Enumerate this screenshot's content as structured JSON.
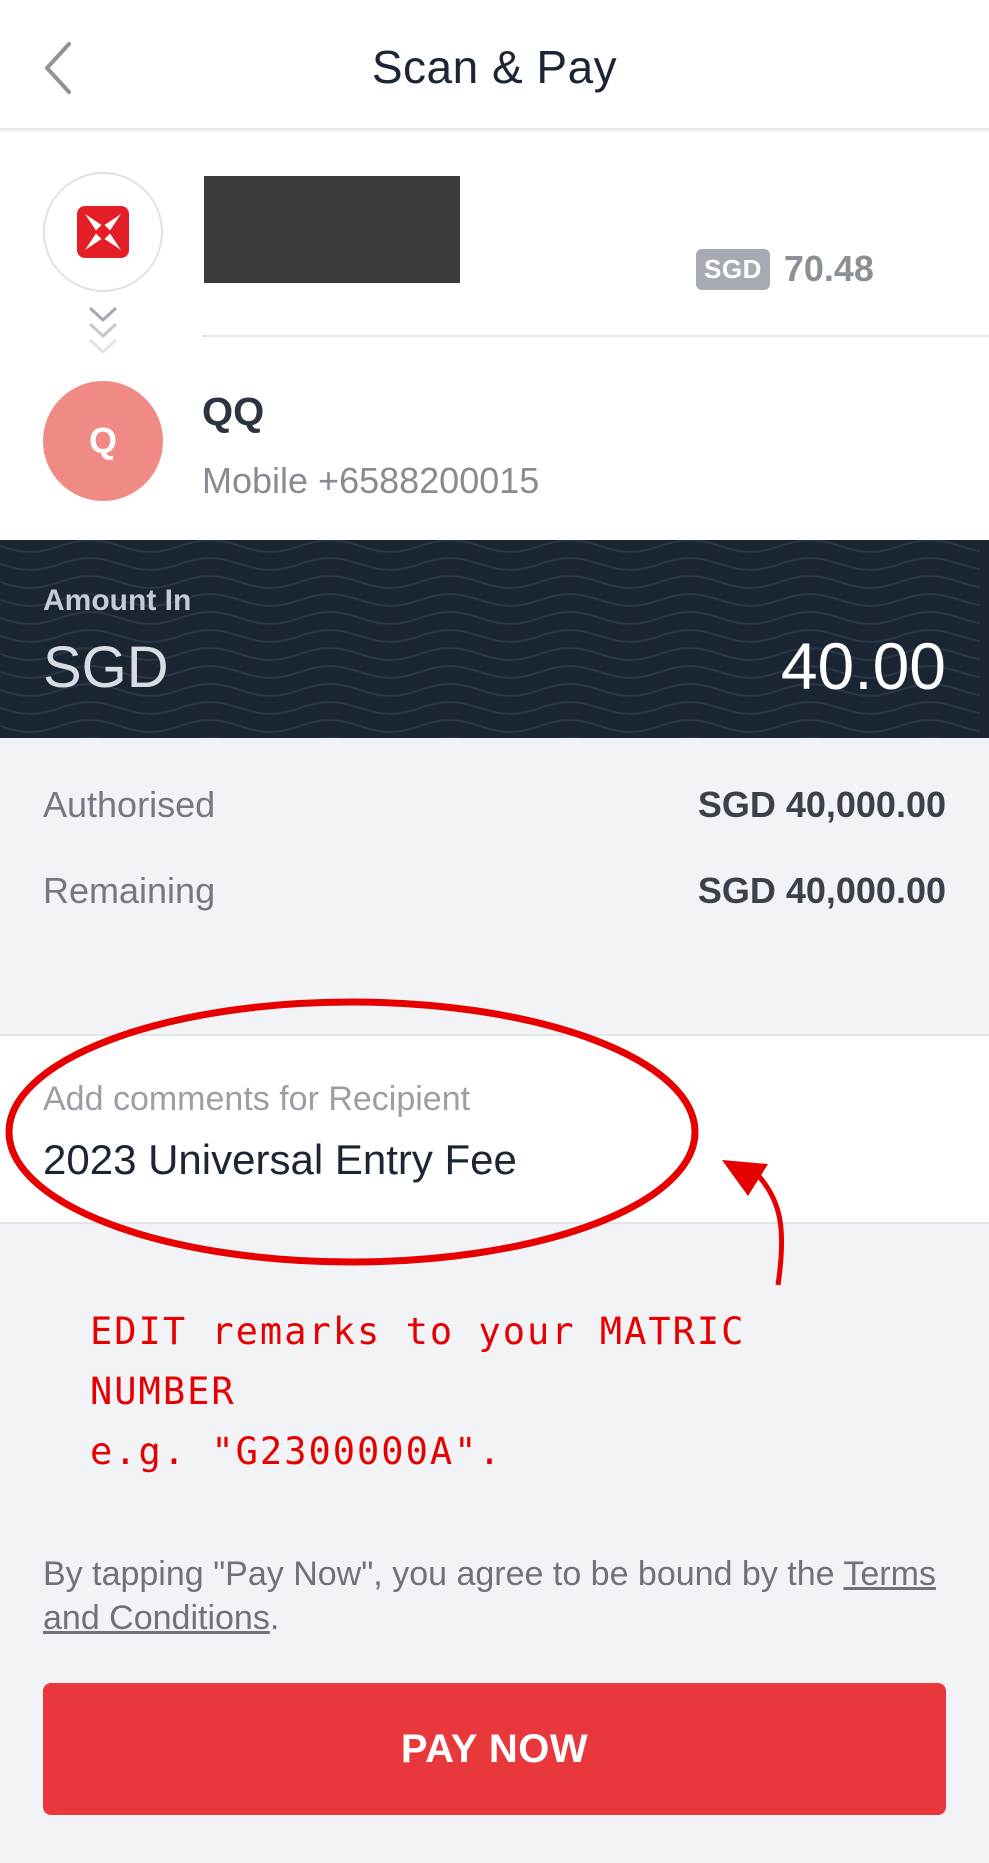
{
  "header": {
    "title": "Scan & Pay",
    "back_icon": "chevron-left-icon"
  },
  "from_account": {
    "logo_icon": "dbs-logo-icon",
    "currency": "SGD",
    "balance": "70.48"
  },
  "recipient": {
    "initial": "Q",
    "name": "QQ",
    "mobile": "Mobile +6588200015"
  },
  "amount": {
    "label": "Amount In",
    "currency": "SGD",
    "value": "40.00"
  },
  "limits": {
    "authorised_label": "Authorised",
    "authorised_value": "SGD 40,000.00",
    "remaining_label": "Remaining",
    "remaining_value": "SGD 40,000.00"
  },
  "comments": {
    "label": "Add comments for Recipient",
    "value": "2023 Universal Entry Fee"
  },
  "annotation": {
    "line1": "EDIT remarks to your MATRIC NUMBER",
    "line2": "e.g. \"G2300000A\"."
  },
  "terms": {
    "prefix": "By tapping \"Pay Now\", you agree to be bound by the ",
    "link": "Terms and Conditions",
    "suffix": "."
  },
  "pay_button": {
    "label": "PAY NOW"
  },
  "colors": {
    "brand_red": "#e8383b",
    "banner_navy": "#1b2532",
    "avatar_salmon": "#ef8a84",
    "annotation_red": "#e60000"
  }
}
